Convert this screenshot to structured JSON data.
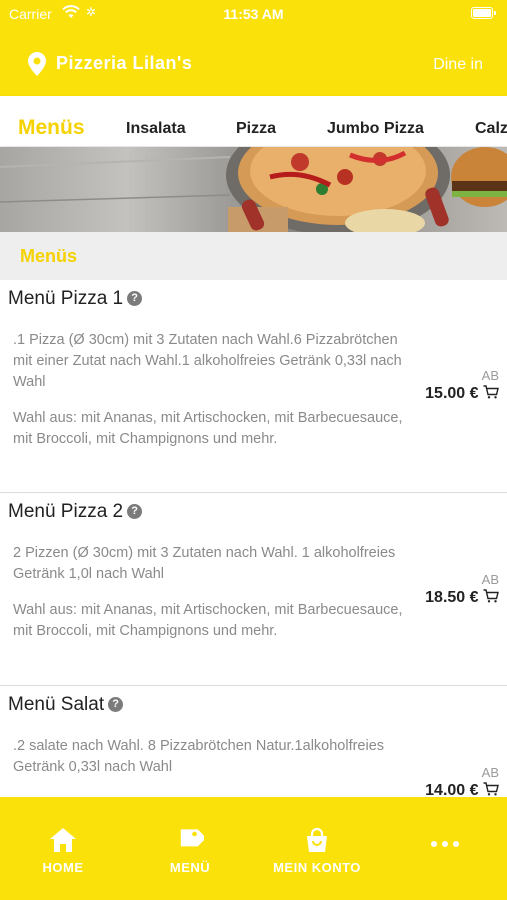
{
  "status": {
    "carrier": "Carrier",
    "time": "11:53 AM"
  },
  "header": {
    "restaurant": "Pizzeria Lilan's",
    "mode": "Dine in"
  },
  "tabs": [
    "Menüs",
    "Insalata",
    "Pizza",
    "Jumbo Pizza",
    "Calz"
  ],
  "section": {
    "title": "Menüs"
  },
  "items": [
    {
      "name": "Menü Pizza 1",
      "desc1": ".1 Pizza (Ø 30cm) mit 3 Zutaten nach Wahl.6 Pizzabrötchen mit einer Zutat nach Wahl.1 alkoholfreies Getränk 0,33l nach Wahl",
      "desc2": "Wahl aus: mit Ananas, mit Artischocken, mit Barbecuesauce, mit Broccoli, mit Champignons und mehr.",
      "ab": "AB",
      "price": "15.00 €"
    },
    {
      "name": "Menü Pizza 2",
      "desc1": "2 Pizzen (Ø 30cm) mit 3 Zutaten nach Wahl. 1 alkoholfreies Getränk 1,0l nach Wahl",
      "desc2": "Wahl aus: mit Ananas, mit Artischocken, mit Barbecuesauce, mit Broccoli, mit Champignons und mehr.",
      "ab": "AB",
      "price": "18.50 €"
    },
    {
      "name": "Menü Salat",
      "desc1": ".2 salate nach Wahl. 8 Pizzabrötchen Natur.1alkoholfreies Getränk 0,33l nach Wahl",
      "ab": "AB",
      "price": "14.00 €"
    }
  ],
  "tabbar": {
    "home": "HOME",
    "menu": "MENÜ",
    "account": "MEIN KONTO"
  },
  "colors": {
    "brand": "#fbe10a",
    "accent_text": "#f5d200"
  },
  "icons": [
    "wifi-icon",
    "location-pin-icon",
    "cart-icon",
    "help-icon",
    "home-icon",
    "tag-icon",
    "shopping-bag-icon",
    "more-icon"
  ]
}
